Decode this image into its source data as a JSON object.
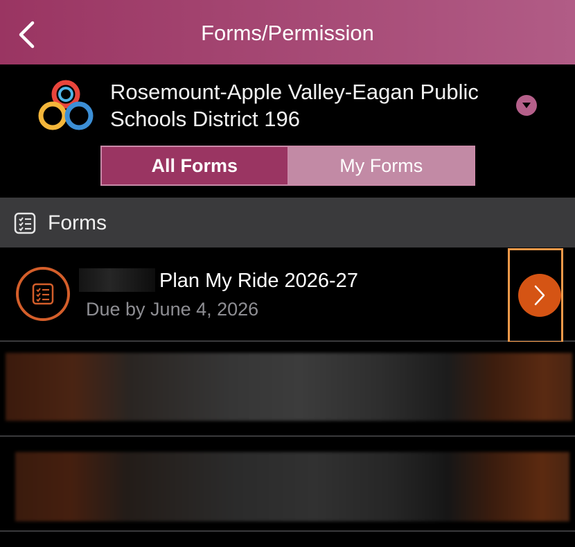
{
  "header": {
    "title": "Forms/Permission",
    "back_icon": "chevron-left-icon"
  },
  "district": {
    "name": "Rosemount-Apple Valley-Eagan Public Schools District 196",
    "dropdown_icon": "caret-down-icon"
  },
  "tabs": [
    {
      "label": "All Forms",
      "selected": true
    },
    {
      "label": "My Forms",
      "selected": false
    }
  ],
  "section": {
    "title": "Forms",
    "icon": "checklist-icon"
  },
  "forms": [
    {
      "title": "Plan My Ride 2026-27",
      "due": "Due by June 4, 2026",
      "icon": "form-checklist-icon",
      "action_icon": "chevron-right-icon"
    }
  ],
  "colors": {
    "header_start": "#9a3562",
    "header_end": "#b15c86",
    "accent_orange": "#d55414",
    "highlight": "#f39a4a",
    "tab_active": "#9a3562",
    "tab_inactive": "#c28aa5"
  }
}
